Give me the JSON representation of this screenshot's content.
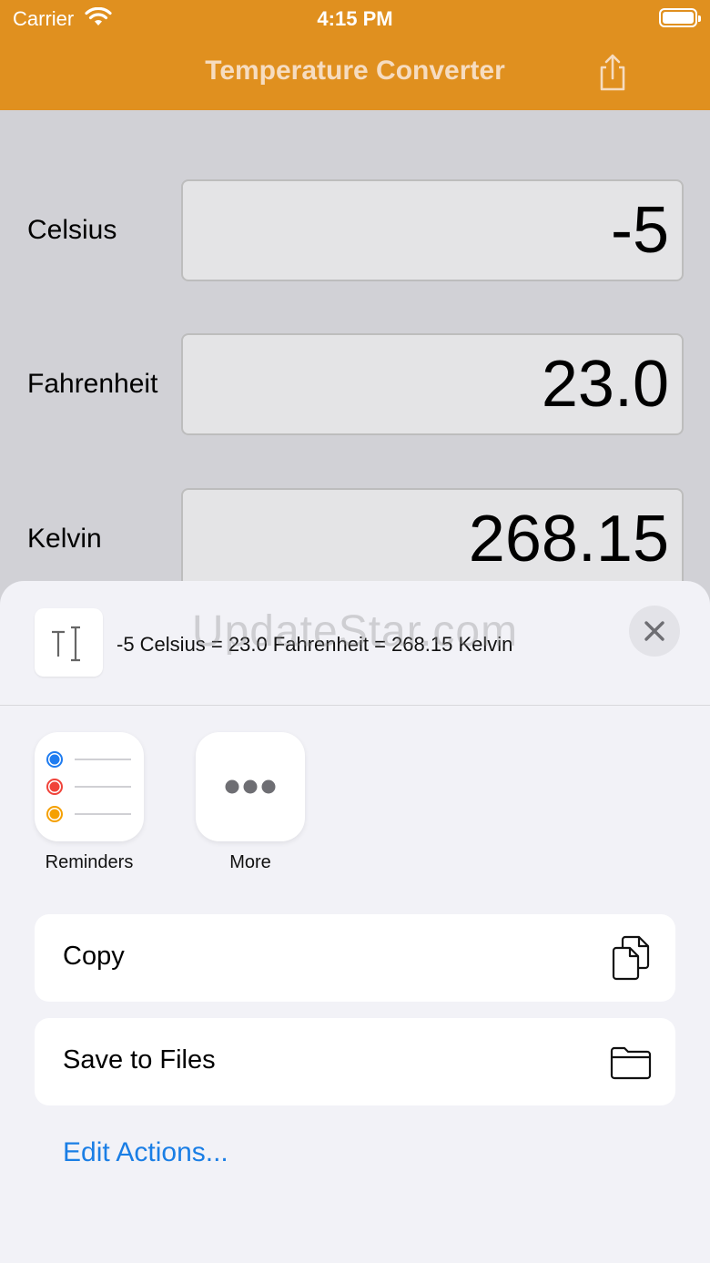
{
  "status_bar": {
    "carrier": "Carrier",
    "time": "4:15 PM"
  },
  "nav": {
    "title": "Temperature Converter",
    "share_icon": "share-icon"
  },
  "rows": [
    {
      "label": "Celsius",
      "value": "-5"
    },
    {
      "label": "Fahrenheit",
      "value": "23.0"
    },
    {
      "label": "Kelvin",
      "value": "268.15"
    }
  ],
  "share_sheet": {
    "preview_text": "-5 Celsius = 23.0 Fahrenheit = 268.15 Kelvin",
    "watermark": "UpdateStar.com",
    "apps": [
      {
        "label": "Reminders",
        "icon": "reminders-icon"
      },
      {
        "label": "More",
        "icon": "more-icon"
      }
    ],
    "actions": [
      {
        "label": "Copy",
        "icon": "copy-icon"
      },
      {
        "label": "Save to Files",
        "icon": "folder-icon"
      }
    ],
    "edit_actions": "Edit Actions..."
  },
  "colors": {
    "header": "#e0901f",
    "title_text": "#f6dcc0",
    "link": "#1a7ee5",
    "background": "#d1d1d6",
    "sheet": "#f2f2f7"
  }
}
